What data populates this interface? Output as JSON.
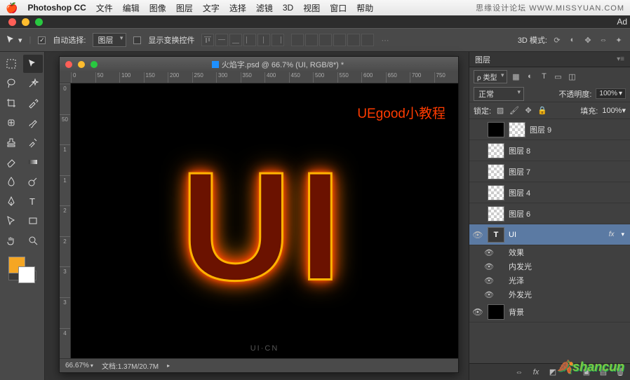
{
  "menubar": {
    "app": "Photoshop CC",
    "items": [
      "文件",
      "编辑",
      "图像",
      "图层",
      "文字",
      "选择",
      "滤镜",
      "3D",
      "视图",
      "窗口",
      "帮助"
    ],
    "right": "思缘设计论坛  WWW.MISSYUAN.COM"
  },
  "app_chrome": {
    "ado": "Ad"
  },
  "options": {
    "auto_select": "自动选择:",
    "auto_select_value": "图层",
    "show_transform": "显示变换控件",
    "mode3d_label": "3D 模式:"
  },
  "document": {
    "title": "火焰字.psd @ 66.7% (UI, RGB/8*) *",
    "ruler_h": [
      "0",
      "50",
      "100",
      "150",
      "200",
      "250",
      "300",
      "350",
      "400",
      "450",
      "500",
      "550",
      "600",
      "650",
      "700",
      "750"
    ],
    "ruler_v": [
      "0",
      "50",
      "1",
      "1",
      "2",
      "2",
      "3",
      "3",
      "4"
    ],
    "brand": "UEgood小教程",
    "ui_text": "UI",
    "logo_bottom": "UI·CN",
    "status_zoom": "66.67%",
    "status_doc": "文档:1.37M/20.7M"
  },
  "layers_panel": {
    "tab": "图层",
    "filter_type": "ρ 类型",
    "blend_mode": "正常",
    "opacity_label": "不透明度:",
    "opacity_value": "100%",
    "lock_label": "锁定:",
    "fill_label": "填充:",
    "fill_value": "100%",
    "layers": [
      {
        "eye": "",
        "name": "图层 9",
        "thumbs": 2
      },
      {
        "eye": "",
        "name": "图层 8",
        "thumbs": 1
      },
      {
        "eye": "",
        "name": "图层 7",
        "thumbs": 1
      },
      {
        "eye": "",
        "name": "图层 4",
        "thumbs": 1
      },
      {
        "eye": "",
        "name": "图层 6",
        "thumbs": 1
      },
      {
        "eye": "👁",
        "name": "UI",
        "type": "T",
        "fx": "fx",
        "selected": true
      },
      {
        "eye": "👁",
        "name": "背景",
        "thumbs": 1,
        "black": true
      }
    ],
    "fx_header": "效果",
    "fx_items": [
      "内发光",
      "光泽",
      "外发光"
    ]
  },
  "watermark": "shancun",
  "colors": {
    "swatch_fg": "#f5a623",
    "swatch_bg": "#ffffff"
  }
}
